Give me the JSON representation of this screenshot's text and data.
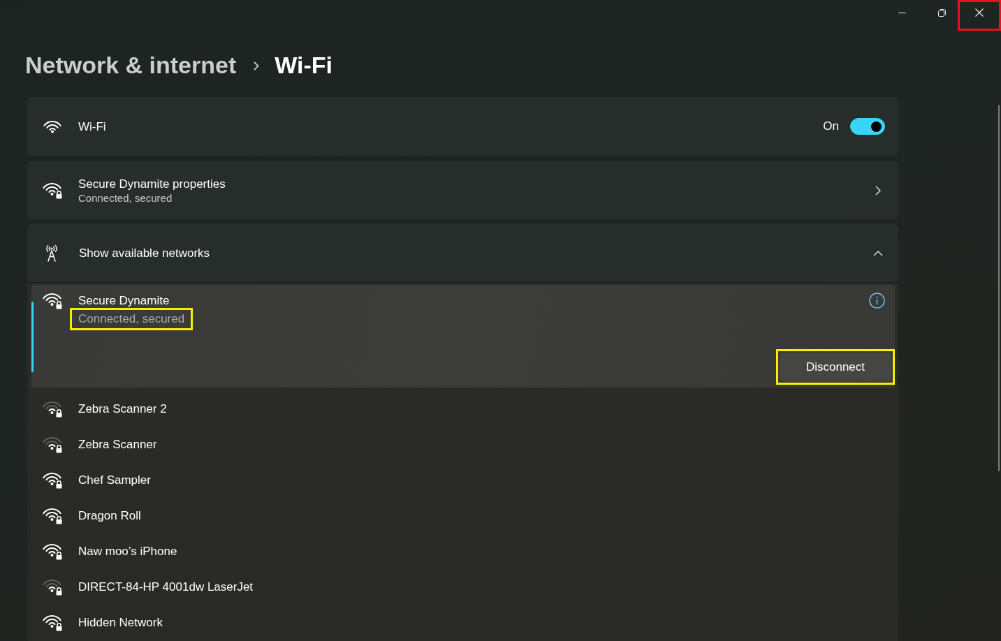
{
  "window": {
    "controls": [
      {
        "kind": "minimize"
      },
      {
        "kind": "restore"
      },
      {
        "kind": "close",
        "highlight": {
          "color": "#e3151c"
        }
      }
    ]
  },
  "breadcrumb": [
    {
      "label": "Network & internet",
      "current": false
    },
    {
      "label": "Wi-Fi",
      "current": true
    }
  ],
  "wifi": {
    "label": "Wi-Fi",
    "state_label": "On",
    "on": true
  },
  "properties": {
    "title": "Secure Dynamite properties",
    "subtitle": "Connected, secured"
  },
  "available_networks": {
    "label": "Show available networks",
    "expanded": true,
    "networks": [
      {
        "name": "Secure Dynamite",
        "selected": true,
        "weak_signal": false,
        "status": "Connected, secured",
        "status_highlight": {
          "color": "#f7ef00"
        },
        "action": {
          "label": "Disconnect",
          "highlight": {
            "color": "#f7ef00"
          }
        }
      },
      {
        "name": "Zebra Scanner 2",
        "selected": false,
        "weak_signal": true
      },
      {
        "name": "Zebra Scanner",
        "selected": false,
        "weak_signal": true
      },
      {
        "name": "Chef Sampler",
        "selected": false,
        "weak_signal": false
      },
      {
        "name": "Dragon Roll",
        "selected": false,
        "weak_signal": false
      },
      {
        "name": "Naw moo’s iPhone",
        "selected": false,
        "weak_signal": false
      },
      {
        "name": "DIRECT-84-HP 4001dw LaserJet",
        "selected": false,
        "weak_signal": true
      },
      {
        "name": "Hidden Network",
        "selected": false,
        "weak_signal": false
      }
    ]
  }
}
